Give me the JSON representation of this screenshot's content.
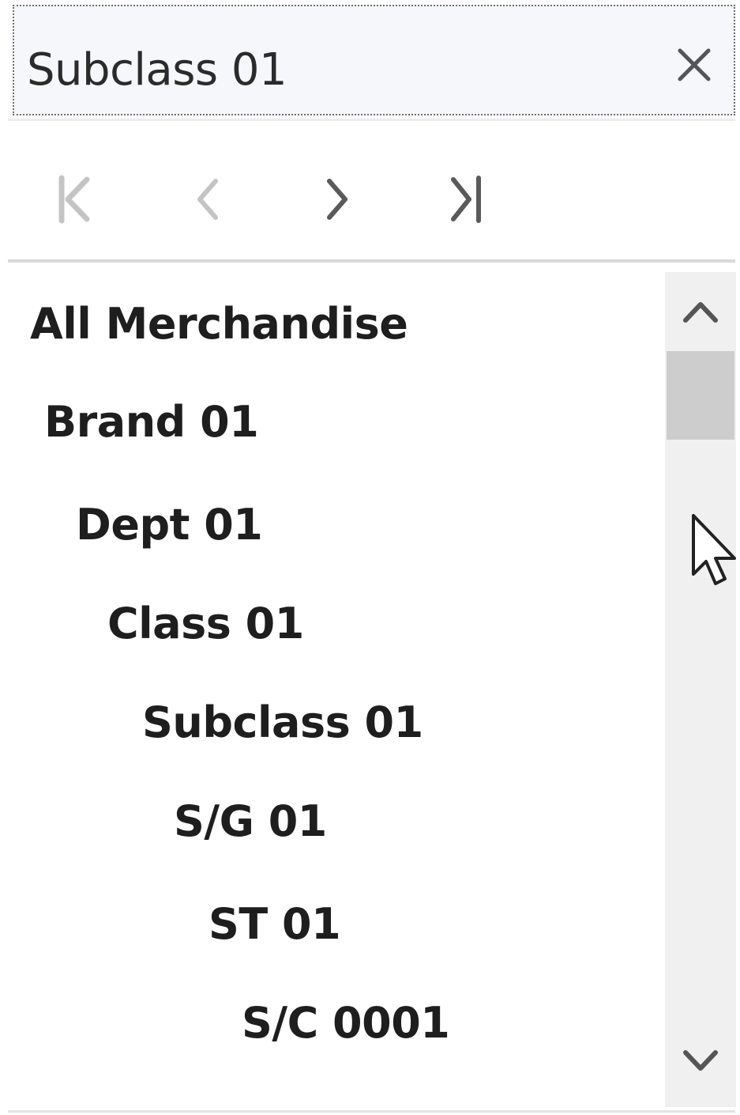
{
  "search": {
    "value": "Subclass 01",
    "clear_icon": "close-icon"
  },
  "pager": {
    "first_icon": "first-page-icon",
    "prev_icon": "chevron-left-icon",
    "next_icon": "chevron-right-icon",
    "last_icon": "last-page-icon",
    "disabled_color": "#c4c4c4",
    "enabled_color": "#5a5a5a"
  },
  "tree": {
    "nodes": [
      {
        "label": "All Merchandise"
      },
      {
        "label": "Brand 01"
      },
      {
        "label": "Dept 01"
      },
      {
        "label": "Class 01"
      },
      {
        "label": "Subclass 01"
      },
      {
        "label": "S/G 01"
      },
      {
        "label": "ST 01"
      },
      {
        "label": "S/C 0001"
      }
    ]
  },
  "scrollbar": {
    "up_icon": "chevron-up-icon",
    "down_icon": "chevron-down-icon",
    "position": 0.0
  },
  "colors": {
    "text": "#1e1e1e",
    "search_bg": "#f6f7fb",
    "scroll_track": "#f0f0f0",
    "scroll_thumb": "#cdcdcd"
  }
}
